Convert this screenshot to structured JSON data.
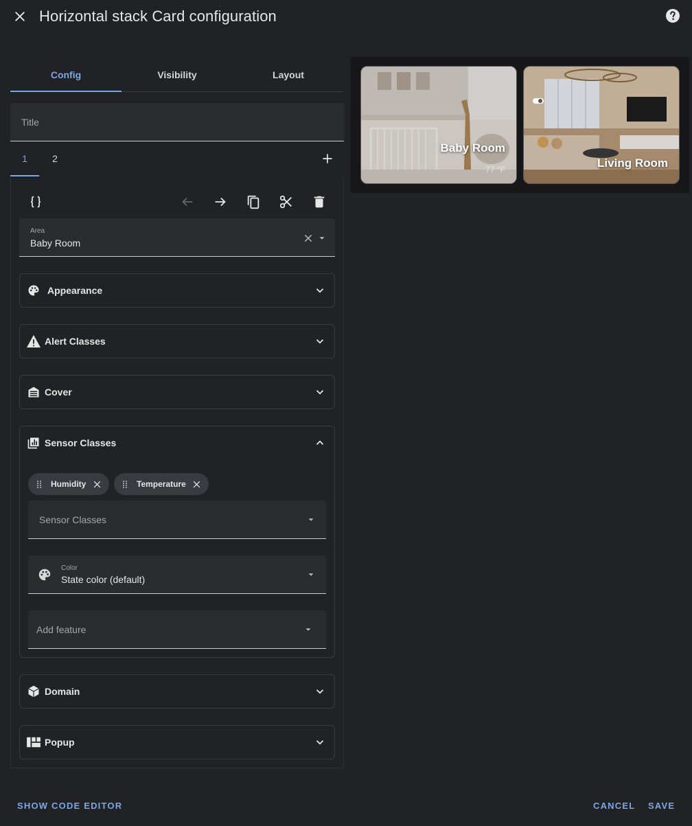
{
  "dialog": {
    "title": "Horizontal stack Card configuration",
    "close_icon": "close-icon",
    "help_icon": "help-circle-icon"
  },
  "tabs": [
    {
      "label": "Config",
      "active": true
    },
    {
      "label": "Visibility",
      "active": false
    },
    {
      "label": "Layout",
      "active": false
    }
  ],
  "title_field": {
    "placeholder": "Title",
    "value": ""
  },
  "card_tabs": [
    {
      "label": "1",
      "active": true
    },
    {
      "label": "2",
      "active": false
    }
  ],
  "add_card_icon": "plus-icon",
  "toolbar": {
    "icons": [
      "code-braces-icon",
      "arrow-left-icon",
      "arrow-right-icon",
      "copy-icon",
      "cut-icon",
      "delete-icon"
    ],
    "move_left_disabled": true
  },
  "area": {
    "label": "Area",
    "value": "Baby Room"
  },
  "sections": {
    "appearance": {
      "label": "Appearance",
      "icon": "palette-icon",
      "expanded": false
    },
    "alert_classes": {
      "label": "Alert Classes",
      "icon": "alert-icon",
      "expanded": false
    },
    "cover": {
      "label": "Cover",
      "icon": "garage-icon",
      "expanded": false
    },
    "sensor_classes": {
      "label": "Sensor Classes",
      "icon": "chart-box-icon",
      "expanded": true
    },
    "domain": {
      "label": "Domain",
      "icon": "cube-icon",
      "expanded": false
    },
    "popup": {
      "label": "Popup",
      "icon": "view-dashboard-icon",
      "expanded": false
    }
  },
  "sensor_classes": {
    "chips": [
      "Humidity",
      "Temperature"
    ],
    "select_placeholder": "Sensor Classes",
    "color": {
      "label": "Color",
      "value": "State color (default)"
    },
    "add_feature_placeholder": "Add feature"
  },
  "preview": {
    "cards": [
      {
        "title": "Baby Room",
        "subtitle": "77 °F"
      },
      {
        "title": "Living Room",
        "subtitle": ""
      }
    ]
  },
  "footer": {
    "show_code_editor": "SHOW CODE EDITOR",
    "cancel": "CANCEL",
    "save": "SAVE"
  },
  "colors": {
    "accent": "#7aa7e8",
    "background": "#212226",
    "field": "#2b2c30"
  }
}
